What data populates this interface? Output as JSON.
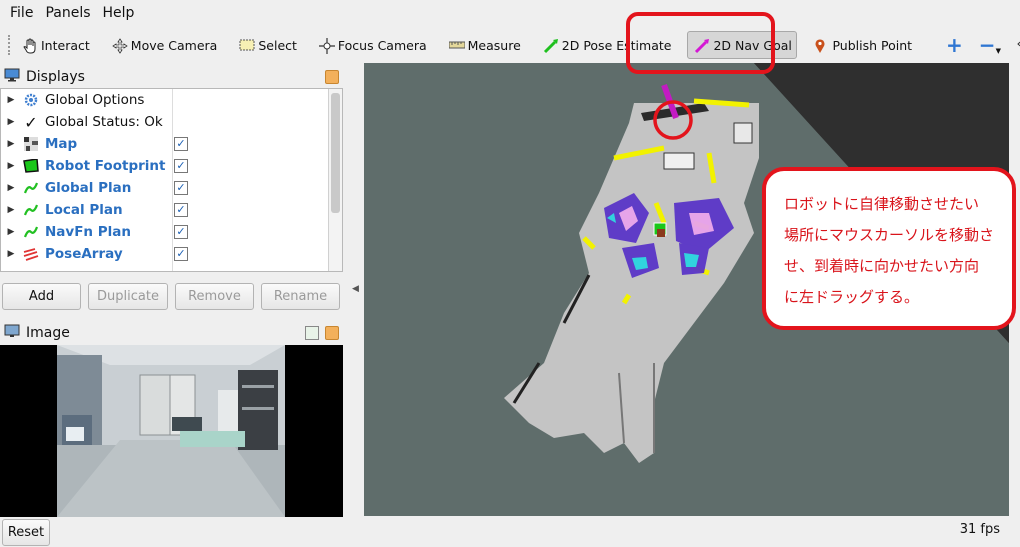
{
  "menu": [
    "File",
    "Panels",
    "Help"
  ],
  "toolbar": {
    "interact": "Interact",
    "move_camera": "Move Camera",
    "select": "Select",
    "focus_camera": "Focus Camera",
    "measure": "Measure",
    "pose_estimate": "2D Pose Estimate",
    "nav_goal": "2D Nav Goal",
    "publish_point": "Publish Point"
  },
  "displays": {
    "title": "Displays",
    "items": [
      {
        "label": "Global Options",
        "icon": "gear-icon",
        "checked": null
      },
      {
        "label": "Global Status: Ok",
        "icon": "check-icon",
        "checked": null
      },
      {
        "label": "Map",
        "icon": "map-icon",
        "checked": true
      },
      {
        "label": "Robot Footprint",
        "icon": "polygon-icon",
        "checked": true
      },
      {
        "label": "Global Plan",
        "icon": "path-icon",
        "checked": true
      },
      {
        "label": "Local Plan",
        "icon": "path-icon",
        "checked": true
      },
      {
        "label": "NavFn Plan",
        "icon": "path-icon",
        "checked": true
      },
      {
        "label": "PoseArray",
        "icon": "posearray-icon",
        "checked": true
      }
    ],
    "buttons": {
      "add": "Add",
      "duplicate": "Duplicate",
      "remove": "Remove",
      "rename": "Rename"
    }
  },
  "image_panel": {
    "title": "Image"
  },
  "bottom": {
    "reset": "Reset",
    "fps": "31 fps"
  },
  "annotation": {
    "text_line1": "ロボットに自律移動させたい",
    "text_line2": "場所にマウスカーソルを移動さ",
    "text_line3": "せ、到着時に向かせたい方向",
    "text_line4": "に左ドラッグする。"
  },
  "colors": {
    "accent_red": "#e3141c",
    "label_blue": "#2a6fc0",
    "grid_floor": "#5f6d6b",
    "map_free": "#c4c4c4"
  }
}
